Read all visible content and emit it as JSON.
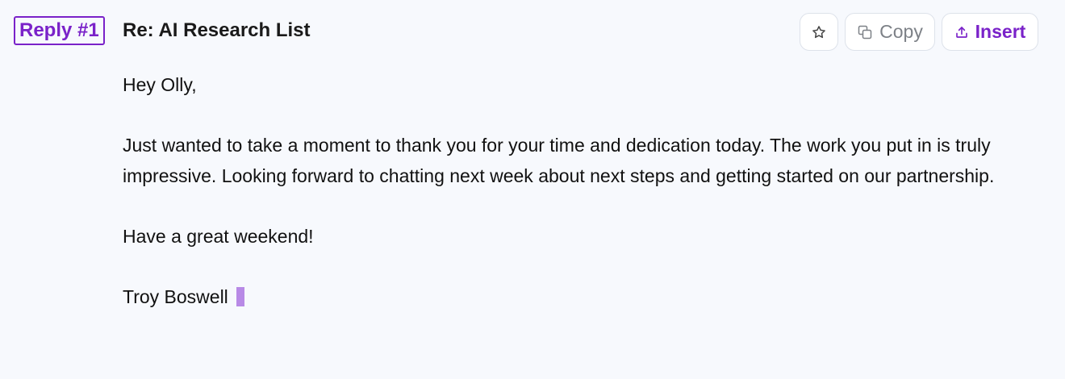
{
  "reply": {
    "badge_label": "Reply #1",
    "subject": "Re: AI Research List"
  },
  "actions": {
    "star_icon": "star-icon",
    "copy_icon": "copy-icon",
    "copy_label": "Copy",
    "insert_icon": "upload-icon",
    "insert_label": "Insert"
  },
  "message": {
    "greeting": "Hey Olly,",
    "paragraph": "Just wanted to take a moment to thank you for your time and dedication today. The work you put in is truly impressive. Looking forward to chatting next week about next steps and getting started on our partnership.",
    "closing": "Have a great weekend!",
    "signature": "Troy Boswell"
  },
  "colors": {
    "accent": "#7a22c9",
    "background": "#f7f9fd",
    "cursor": "#b88ae6",
    "muted_text": "#7d8187"
  }
}
